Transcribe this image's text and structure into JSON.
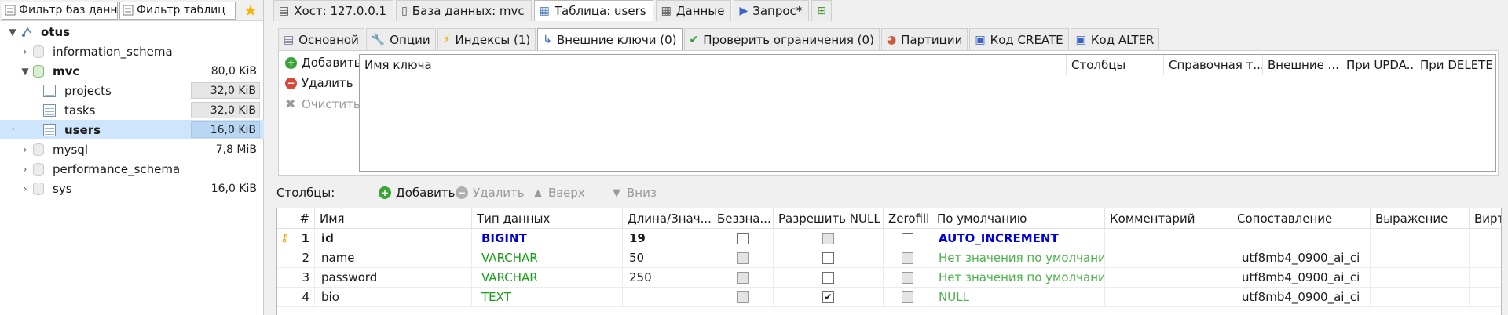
{
  "colors": {
    "bigint": "#0000d8",
    "varchar": "#189c18",
    "selected_row": "#cfe5fb",
    "star": "#f4b400"
  },
  "filters": {
    "db_filter": "Фильтр баз данн",
    "table_filter": "Фильтр таблиц"
  },
  "tree": {
    "root": "otus",
    "items": [
      {
        "label": "information_schema",
        "size": ""
      },
      {
        "label": "mvc",
        "size": "80,0 KiB"
      },
      {
        "label": "projects",
        "size": "32,0 KiB"
      },
      {
        "label": "tasks",
        "size": "32,0 KiB"
      },
      {
        "label": "users",
        "size": "16,0 KiB"
      },
      {
        "label": "mysql",
        "size": "7,8 MiB"
      },
      {
        "label": "performance_schema",
        "size": ""
      },
      {
        "label": "sys",
        "size": "16,0 KiB"
      }
    ]
  },
  "toptabs": {
    "host": "Хост: 127.0.0.1",
    "database": "База данных: mvc",
    "table": "Таблица: users",
    "data": "Данные",
    "query": "Запрос*"
  },
  "subtabs": {
    "basic": "Основной",
    "options": "Опции",
    "indexes": "Индексы (1)",
    "foreign_keys": "Внешние ключи (0)",
    "checks": "Проверить ограничения (0)",
    "partitions": "Партиции",
    "create_code": "Код CREATE",
    "alter_code": "Код ALTER"
  },
  "keys": {
    "add": "Добавить",
    "remove": "Удалить",
    "clear": "Очистить",
    "headers": [
      "Имя ключа",
      "Столбцы",
      "Справочная т...",
      "Внешние ...",
      "При UPDA...",
      "При DELETE"
    ]
  },
  "columns_toolbar": {
    "label": "Столбцы:",
    "add": "Добавить",
    "remove": "Удалить",
    "up": "Вверх",
    "down": "Вниз"
  },
  "grid": {
    "headers": [
      "#",
      "Имя",
      "Тип данных",
      "Длина/Знач...",
      "Беззна...",
      "Разрешить NULL",
      "Zerofill",
      "По умолчанию",
      "Комментарий",
      "Сопоставление",
      "Выражение",
      "Вирт"
    ],
    "rows": [
      {
        "num": "1",
        "name": "id",
        "type": "BIGINT",
        "length": "19",
        "unsigned": false,
        "allow_null": false,
        "zerofill": false,
        "default": "AUTO_INCREMENT",
        "comment": "",
        "collation": "",
        "expression": "",
        "key": true
      },
      {
        "num": "2",
        "name": "name",
        "type": "VARCHAR",
        "length": "50",
        "unsigned": false,
        "allow_null": false,
        "zerofill": false,
        "default": "Нет значения по умолчанию",
        "comment": "",
        "collation": "utf8mb4_0900_ai_ci",
        "expression": "",
        "key": false
      },
      {
        "num": "3",
        "name": "password",
        "type": "VARCHAR",
        "length": "250",
        "unsigned": false,
        "allow_null": false,
        "zerofill": false,
        "default": "Нет значения по умолчанию",
        "comment": "",
        "collation": "utf8mb4_0900_ai_ci",
        "expression": "",
        "key": false
      },
      {
        "num": "4",
        "name": "bio",
        "type": "TEXT",
        "length": "",
        "unsigned": false,
        "allow_null": true,
        "zerofill": false,
        "default": "NULL",
        "comment": "",
        "collation": "utf8mb4_0900_ai_ci",
        "expression": "",
        "key": false
      }
    ]
  }
}
